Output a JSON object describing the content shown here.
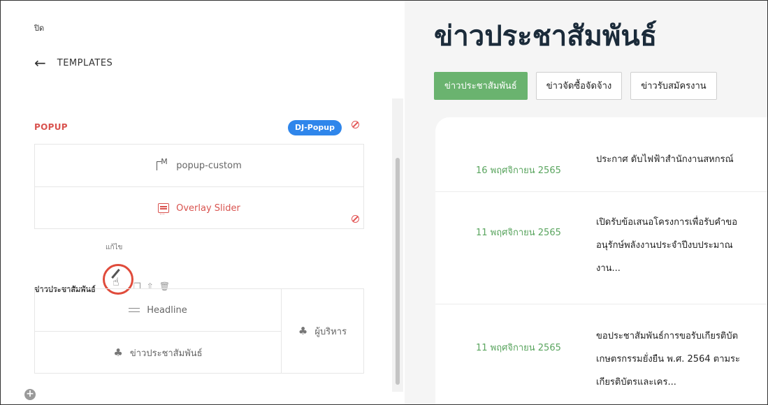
{
  "left_panel": {
    "close_label": "ปิด",
    "back_label": "TEMPLATES",
    "popup_section": {
      "title": "POPUP",
      "badge": "DJ-Popup",
      "items": [
        {
          "label": "popup-custom",
          "icon": "m-template-icon"
        },
        {
          "label": "Overlay Slider",
          "icon": "slider-icon"
        }
      ]
    },
    "tooltip": "แก้ไข",
    "news_section": {
      "title": "ข่าวประชาสัมพันธ์",
      "actions": [
        "edit-icon",
        "copy-icon",
        "export-icon",
        "delete-icon"
      ],
      "items": [
        {
          "label": "Headline",
          "icon": "lines-icon"
        },
        {
          "label": "ข่าวประชาสัมพันธ์",
          "icon": "widget-icon"
        }
      ],
      "side_item": {
        "label": "ผู้บริหาร",
        "icon": "widget-icon"
      }
    }
  },
  "right_panel": {
    "page_title": "ข่าวประชาสัมพันธ์",
    "tabs": [
      {
        "label": "ข่าวประชาสัมพันธ์",
        "active": true
      },
      {
        "label": "ข่าวจัดซื้อจัดจ้าง",
        "active": false
      },
      {
        "label": "ข่าวรับสมัครงาน",
        "active": false
      }
    ],
    "news": [
      {
        "date": "16 พฤศจิกายน 2565",
        "lines": [
          "ประกาศ ดับไฟฟ้าสำนักงานสหกรณ์"
        ]
      },
      {
        "date": "11 พฤศจิกายน 2565",
        "lines": [
          "เปิดรับข้อเสนอโครงการเพื่อรับคำขอ",
          "อนุรักษ์พลังงานประจำปีงบประมาณ",
          "งาน..."
        ]
      },
      {
        "date": "11 พฤศจิกายน 2565",
        "lines": [
          "ขอประชาสัมพันธ์การขอรับเกียรติบัต",
          "เกษตรกรรมยั่งยืน พ.ศ. 2564 ตามระ",
          "เกียรติบัตรและเคร..."
        ]
      }
    ]
  },
  "colors": {
    "accent_red": "#d9534f",
    "badge_blue": "#2f86eb",
    "active_green": "#6ab36f",
    "date_green": "#5aa55f"
  }
}
